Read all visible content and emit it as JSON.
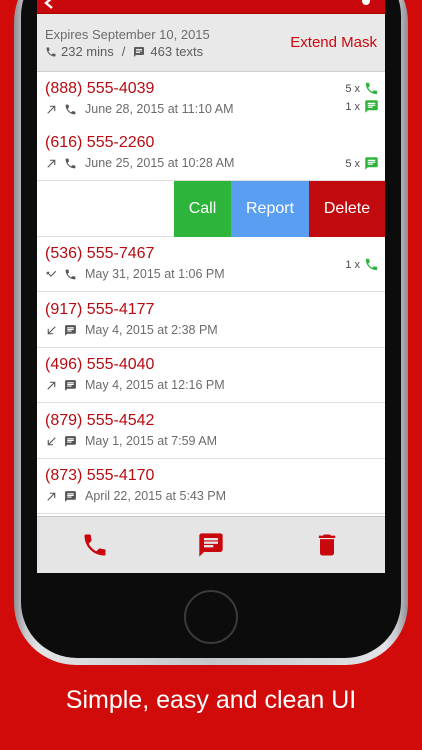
{
  "status": {
    "expires": "Expires September 10, 2015",
    "minutes": "232 mins",
    "separator": "/",
    "texts": "463 texts",
    "extend_label": "Extend Mask"
  },
  "entries": [
    {
      "number": "(888) 555-4039",
      "date": "June 28, 2015 at 11:10 AM",
      "direction": "outgoing",
      "type": "call",
      "call_count": "5 x",
      "text_count": "1 x"
    },
    {
      "number": "(616) 555-2260",
      "date": "June 25, 2015 at 10:28 AM",
      "direction": "outgoing",
      "type": "call",
      "text_count": "5 x"
    },
    {
      "number": "(536) 555-7467",
      "date": "May 31, 2015 at 1:06 PM",
      "direction": "missed",
      "type": "call",
      "call_count": "1 x"
    },
    {
      "number": "(917) 555-4177",
      "date": "May 4, 2015 at 2:38 PM",
      "direction": "incoming",
      "type": "text"
    },
    {
      "number": "(496) 555-4040",
      "date": "May 4, 2015 at 12:16 PM",
      "direction": "outgoing",
      "type": "text"
    },
    {
      "number": "(879) 555-4542",
      "date": "May 1, 2015 at 7:59 AM",
      "direction": "incoming",
      "type": "text"
    },
    {
      "number": "(873) 555-4170",
      "date": "April 22, 2015 at 5:43 PM",
      "direction": "outgoing",
      "type": "text"
    }
  ],
  "swipe_actions": {
    "call": "Call",
    "report": "Report",
    "delete": "Delete"
  },
  "tabbar": {
    "icons": [
      "phone-icon",
      "message-icon",
      "trash-icon"
    ]
  },
  "tagline": "Simple, easy and clean UI",
  "colors": {
    "brand_red": "#c9080d",
    "call_green": "#2db53b",
    "report_blue": "#5a9ef2",
    "background": "#d10a0a"
  }
}
